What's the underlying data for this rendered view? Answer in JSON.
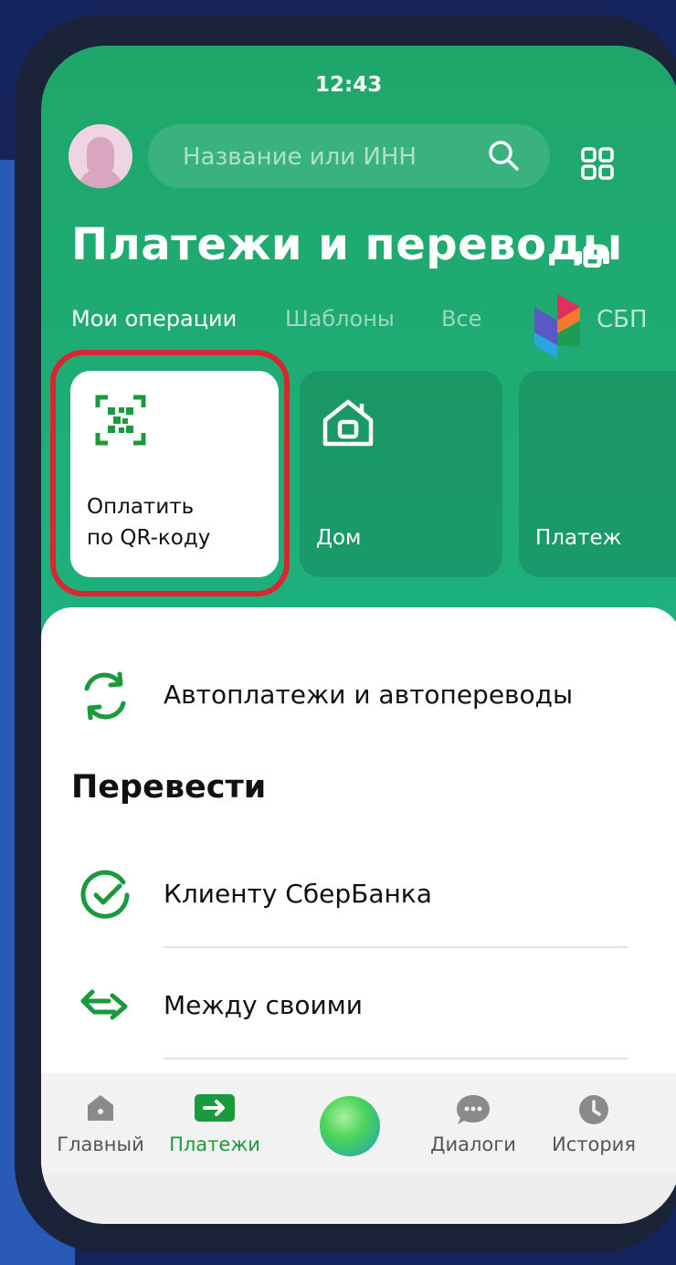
{
  "status": {
    "time": "12:43"
  },
  "header": {
    "search_placeholder": "Название или ИНН",
    "title": "Платежи и переводы"
  },
  "tabs": [
    {
      "label": "Мои операции",
      "active": true
    },
    {
      "label": "Шаблоны",
      "active": false
    },
    {
      "label": "Все",
      "active": false
    }
  ],
  "sbp": {
    "label": "СБП"
  },
  "cards": [
    {
      "label": "Оплатить\nпо QR-коду",
      "icon": "qr-code-icon"
    },
    {
      "label": "Дом",
      "icon": "house-icon"
    },
    {
      "label": "Платеж",
      "icon": ""
    }
  ],
  "autopay": {
    "label": "Автоплатежи и автопереводы"
  },
  "transfer": {
    "title": "Перевести",
    "items": [
      {
        "label": "Клиенту СберБанка",
        "icon": "check-circle-icon"
      },
      {
        "label": "Между своими",
        "icon": "arrows-exchange-icon"
      }
    ]
  },
  "bottom_nav": [
    {
      "label": "Главный",
      "icon": "home-icon",
      "active": false
    },
    {
      "label": "Платежи",
      "icon": "payment-arrow-icon",
      "active": true
    },
    {
      "label": "",
      "icon": "assistant-orb-icon",
      "active": false
    },
    {
      "label": "Диалоги",
      "icon": "chat-bubble-icon",
      "active": false
    },
    {
      "label": "История",
      "icon": "clock-icon",
      "active": false
    }
  ],
  "colors": {
    "brand_green": "#1fa66a",
    "highlight_red": "#d8272e",
    "active_tab_green": "#1a9a3c"
  }
}
